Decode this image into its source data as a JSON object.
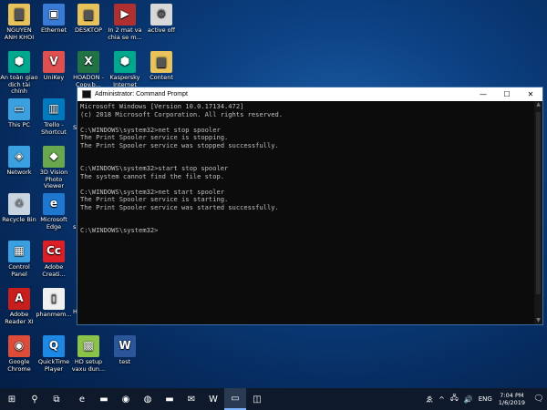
{
  "desktop_icons": [
    {
      "label": "NGUYEN ANH KHOI",
      "icon": "user-folder-icon",
      "color": "#e8c25a"
    },
    {
      "label": "Ethernet",
      "icon": "network-computer-icon",
      "color": "#3a7bd5"
    },
    {
      "label": "DESKTOP",
      "icon": "folder-icon",
      "color": "#e8c25a"
    },
    {
      "label": "In 2 mat va chia se m...",
      "icon": "video-file-icon",
      "color": "#b03030"
    },
    {
      "label": "active off",
      "icon": "settings-file-icon",
      "color": "#d8d8d8"
    },
    {
      "label": "An toàn giao dịch tài chính",
      "icon": "kaspersky-shield-icon",
      "color": "#00a88e"
    },
    {
      "label": "UniKey",
      "icon": "unikey-icon",
      "color": "#e05050"
    },
    {
      "label": "HOADON - Copy.b...",
      "icon": "excel-icon",
      "color": "#217346"
    },
    {
      "label": "Kaspersky Internet",
      "icon": "kaspersky-icon",
      "color": "#00a88e"
    },
    {
      "label": "Content",
      "icon": "folder-icon",
      "color": "#e8c25a"
    },
    {
      "label": "This PC",
      "icon": "this-pc-icon",
      "color": "#3aa0e0"
    },
    {
      "label": "Trello - Shortcut",
      "icon": "trello-icon",
      "color": "#0079bf"
    },
    {
      "label": "Network",
      "icon": "network-icon",
      "color": "#3aa0e0"
    },
    {
      "label": "3D Vision Photo Viewer",
      "icon": "3d-vision-icon",
      "color": "#6aa84f"
    },
    {
      "label": "Recycle Bin",
      "icon": "recycle-bin-icon",
      "color": "#c8d4e0"
    },
    {
      "label": "Microsoft Edge",
      "icon": "edge-icon",
      "color": "#1e78d0"
    },
    {
      "label": "Control Panel",
      "icon": "control-panel-icon",
      "color": "#3aa0e0"
    },
    {
      "label": "Adobe Creati...",
      "icon": "adobe-cc-icon",
      "color": "#da1f26"
    },
    {
      "label": "Adobe Reader XI",
      "icon": "adobe-reader-icon",
      "color": "#c81e1e"
    },
    {
      "label": "phanmem...",
      "icon": "document-icon",
      "color": "#f0f0f0"
    },
    {
      "label": "Google Chrome",
      "icon": "chrome-icon",
      "color": "#dd4b39"
    },
    {
      "label": "QuickTime Player",
      "icon": "quicktime-icon",
      "color": "#1e88e5"
    },
    {
      "label": "HD setup vaxu dun...",
      "icon": "image-file-icon",
      "color": "#8bc34a"
    },
    {
      "label": "test",
      "icon": "word-icon",
      "color": "#2b579a"
    }
  ],
  "partial_labels": {
    "sc": "Sc",
    "pc": "sPC",
    "h1": "H",
    "h2": "H",
    "s": "s"
  },
  "cmd": {
    "title": "Administrator: Command Prompt",
    "minimize": "—",
    "maximize": "☐",
    "close": "✕",
    "lines": [
      "Microsoft Windows [Version 10.0.17134.472]",
      "(c) 2018 Microsoft Corporation. All rights reserved.",
      "",
      "C:\\WINDOWS\\system32>net stop spooler",
      "The Print Spooler service is stopping.",
      "The Print Spooler service was stopped successfully.",
      "",
      "",
      "C:\\WINDOWS\\system32>start stop spooler",
      "The system cannot find the file stop.",
      "",
      "C:\\WINDOWS\\system32>net start spooler",
      "The Print Spooler service is starting.",
      "The Print Spooler service was started successfully.",
      "",
      "",
      "C:\\WINDOWS\\system32>"
    ]
  },
  "taskbar": {
    "items": [
      {
        "icon": "windows-start-icon",
        "glyph": "⊞"
      },
      {
        "icon": "search-icon",
        "glyph": "⚲"
      },
      {
        "icon": "task-view-icon",
        "glyph": "⧉"
      },
      {
        "icon": "edge-icon",
        "glyph": "e"
      },
      {
        "icon": "file-explorer-icon",
        "glyph": "▬"
      },
      {
        "icon": "chrome-icon",
        "glyph": "◉"
      },
      {
        "icon": "firefox-icon",
        "glyph": "◍"
      },
      {
        "icon": "folder-icon",
        "glyph": "▬"
      },
      {
        "icon": "mail-icon",
        "glyph": "✉"
      },
      {
        "icon": "word-icon",
        "glyph": "W"
      },
      {
        "icon": "command-prompt-icon",
        "glyph": "▭",
        "active": true
      },
      {
        "icon": "app-icon",
        "glyph": "◫"
      }
    ],
    "tray": {
      "ime": "ゑ",
      "chevron": "^",
      "network_icon": "🖧",
      "volume_icon": "🔊",
      "language": "ENG",
      "time": "7:04 PM",
      "date": "1/6/2019",
      "notifications_icon": "🗨"
    }
  }
}
